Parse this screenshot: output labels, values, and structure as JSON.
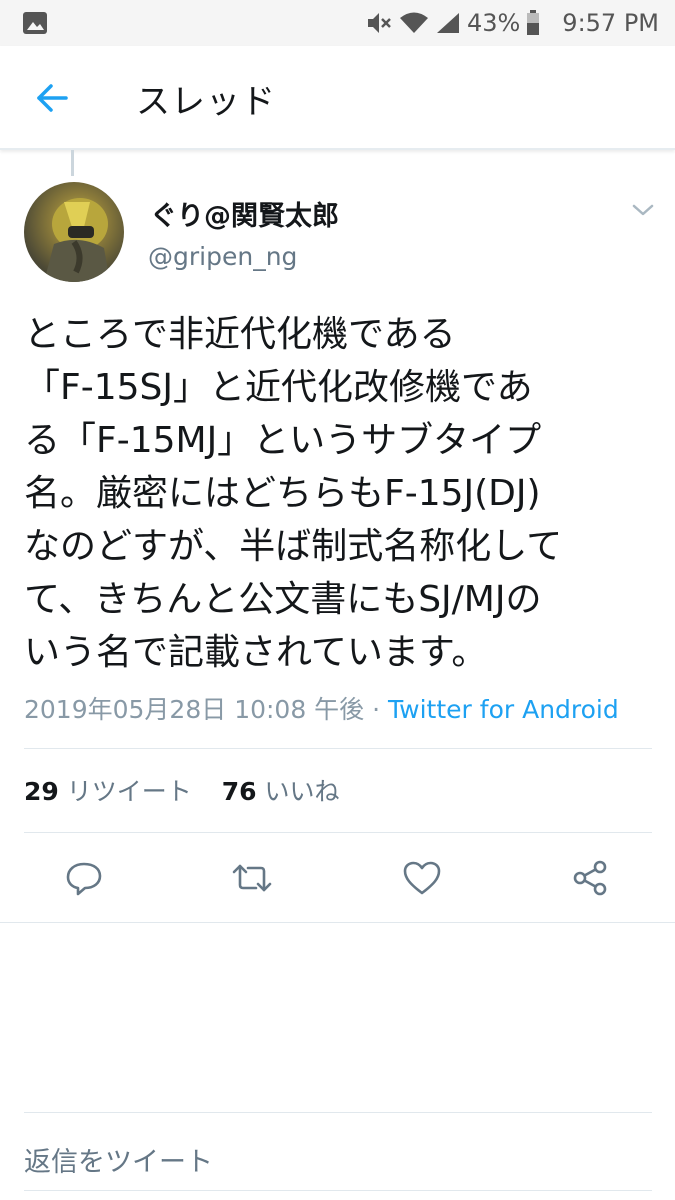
{
  "status_bar": {
    "battery_percent": "43%",
    "time": "9:57 PM"
  },
  "app_bar": {
    "title": "スレッド"
  },
  "tweet": {
    "display_name": "ぐり@関賢太郎",
    "username": "@gripen_ng",
    "text": "ところで非近代化機である\n「F-15SJ」と近代化改修機であ\nる「F-15MJ」というサブタイプ\n名。厳密にはどちらもF-15J(DJ)\nなのどすが、半ば制式名称化して\nて、きちんと公文書にもSJ/MJの\nいう名で記載されています。",
    "timestamp": "2019年05月28日 10:08 午後",
    "separator": " · ",
    "source": "Twitter for Android",
    "retweet_count": "29",
    "retweet_label": "リツイート",
    "like_count": "76",
    "like_label": "いいね"
  },
  "reply": {
    "placeholder": "返信をツイート"
  },
  "colors": {
    "accent": "#1da1f2",
    "muted": "#657786",
    "icon": "#657786"
  }
}
